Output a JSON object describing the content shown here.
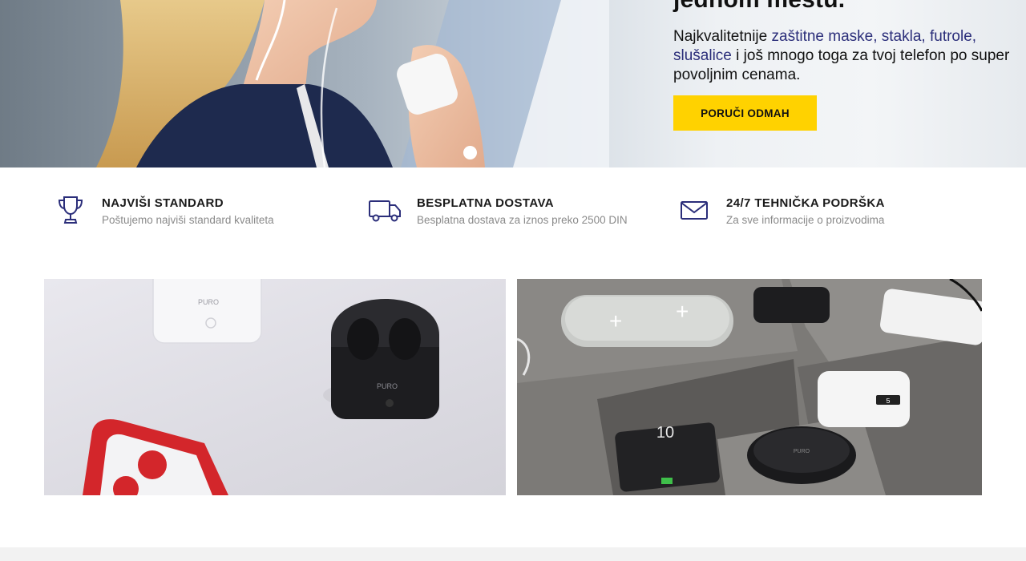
{
  "hero": {
    "heading": "jednom mestu.",
    "desc_before": "Najkvalitetnije ",
    "desc_highlight": "zaštitne maske, stakla, futrole, slušalice",
    "desc_after": " i još mnogo toga za tvoj telefon po super povoljnim cenama.",
    "cta_label": "PORUČI ODMAH",
    "highlight_color": "#2b2e7a",
    "cta_color": "#ffd200"
  },
  "features": [
    {
      "icon": "trophy-icon",
      "title": "NAJVIŠI STANDARD",
      "subtitle": "Poštujemo najviši standard kvaliteta"
    },
    {
      "icon": "truck-icon",
      "title": "BESPLATNA DOSTAVA",
      "subtitle": "Besplatna dostava za iznos preko 2500 DIN"
    },
    {
      "icon": "envelope-icon",
      "title": "24/7 TEHNIČKA PODRŠKA",
      "subtitle": "Za sve informacije o proizvodima"
    }
  ],
  "banners": {
    "left": {
      "brand": "PURO"
    },
    "right": {
      "brand": "PURO",
      "powerbank_label": "10",
      "small_label": "5"
    }
  }
}
